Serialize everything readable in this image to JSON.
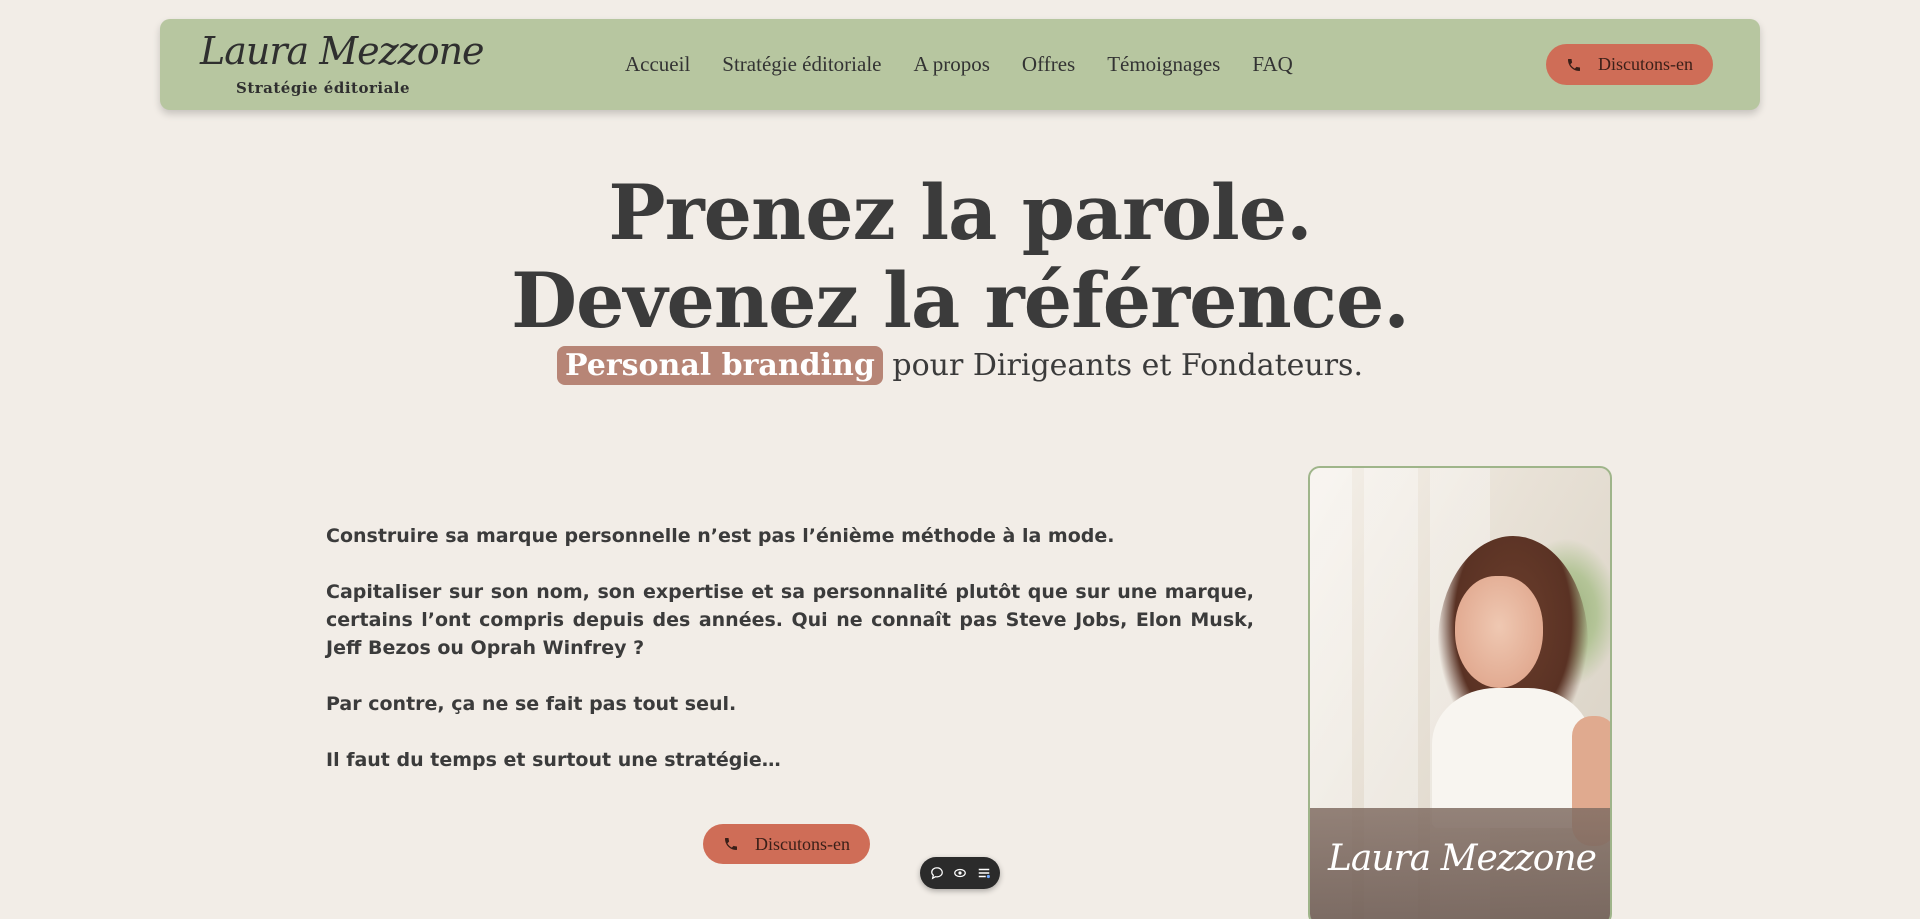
{
  "header": {
    "logo": {
      "script": "Laura Mezzone",
      "subtitle": "Stratégie éditoriale"
    },
    "nav": [
      {
        "label": "Accueil"
      },
      {
        "label": "Stratégie éditoriale"
      },
      {
        "label": "A propos"
      },
      {
        "label": "Offres"
      },
      {
        "label": "Témoignages"
      },
      {
        "label": "FAQ"
      }
    ],
    "cta_label": "Discutons-en"
  },
  "hero": {
    "line1": "Prenez la parole.",
    "line2": "Devenez la référence.",
    "highlight": "Personal branding",
    "subtitle_rest": "pour Dirigeants et Fondateurs."
  },
  "content": {
    "paragraphs": [
      "Construire sa marque personnelle n’est pas l’énième méthode à la mode.",
      "Capitaliser sur son nom, son expertise et sa personnalité plutôt que sur une marque, certains l’ont compris depuis des années. Qui ne connaît pas Steve Jobs, Elon Musk, Jeff Bezos ou Oprah Winfrey ?",
      "Par contre, ça ne se fait pas tout seul.",
      "Il faut du temps et surtout une stratégie…"
    ],
    "cta_label": "Discutons-en"
  },
  "photo": {
    "signature": "Laura Mezzone"
  },
  "widget": {
    "icons": [
      "chat-icon",
      "eye-icon",
      "settings-list-icon"
    ]
  },
  "colors": {
    "background": "#f2ede7",
    "header": "#b7c6a0",
    "cta": "#cf6d57",
    "highlight": "#b78576",
    "text": "#3b3b3b"
  }
}
